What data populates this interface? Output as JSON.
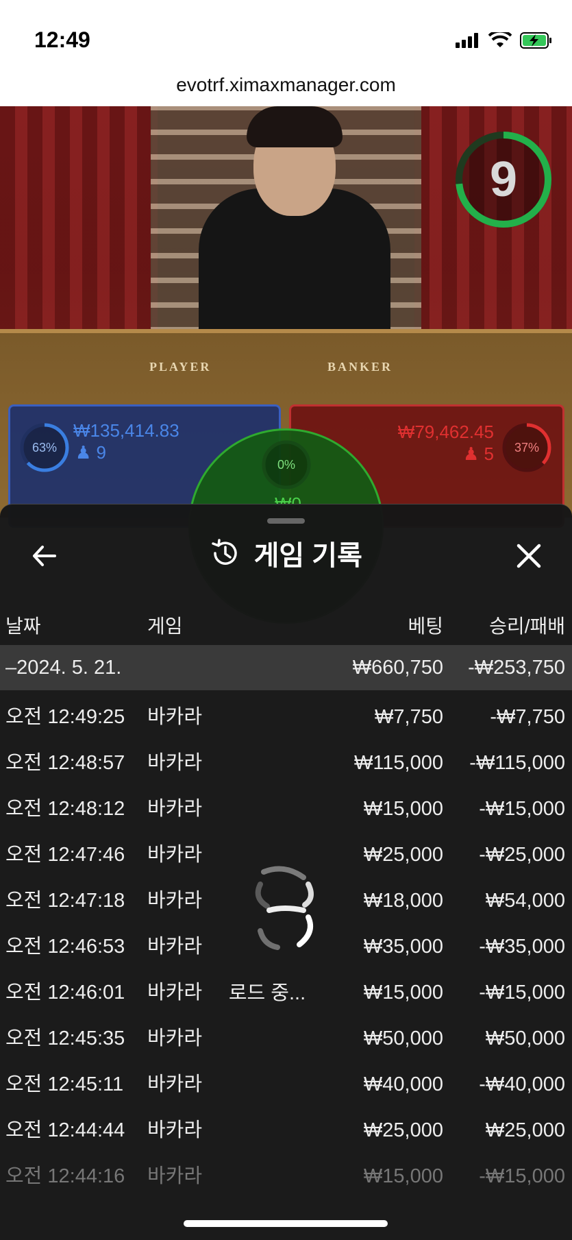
{
  "status_bar": {
    "time": "12:49"
  },
  "browser": {
    "url": "evotrf.ximaxmanager.com"
  },
  "game": {
    "timer": "9",
    "table_labels": {
      "player": "PLAYER",
      "banker": "BANKER"
    },
    "player": {
      "pct": "63%",
      "amount": "₩135,414.83",
      "count": "9"
    },
    "banker": {
      "pct": "37%",
      "amount": "₩79,462.45",
      "count": "5"
    },
    "tie": {
      "pct": "0%",
      "amount": "₩0"
    },
    "colors": {
      "player": "#3a5fc0",
      "banker": "#c03030",
      "tie": "#2faa2f"
    }
  },
  "sheet": {
    "title": "게임 기록",
    "columns": {
      "date": "날짜",
      "game": "게임",
      "bet": "베팅",
      "result": "승리/패배"
    },
    "summary": {
      "date": "–2024. 5. 21.",
      "bet": "₩660,750",
      "result": "-₩253,750"
    },
    "rows": [
      {
        "time": "오전 12:49:25",
        "game": "바카라",
        "bet": "₩7,750",
        "result": "-₩7,750"
      },
      {
        "time": "오전 12:48:57",
        "game": "바카라",
        "bet": "₩115,000",
        "result": "-₩115,000"
      },
      {
        "time": "오전 12:48:12",
        "game": "바카라",
        "bet": "₩15,000",
        "result": "-₩15,000"
      },
      {
        "time": "오전 12:47:46",
        "game": "바카라",
        "bet": "₩25,000",
        "result": "-₩25,000"
      },
      {
        "time": "오전 12:47:18",
        "game": "바카라",
        "bet": "₩18,000",
        "result": "₩54,000"
      },
      {
        "time": "오전 12:46:53",
        "game": "바카라",
        "bet": "₩35,000",
        "result": "-₩35,000"
      },
      {
        "time": "오전 12:46:01",
        "game": "바카라",
        "bet": "₩15,000",
        "result": "-₩15,000"
      },
      {
        "time": "오전 12:45:35",
        "game": "바카라",
        "bet": "₩50,000",
        "result": "₩50,000"
      },
      {
        "time": "오전 12:45:11",
        "game": "바카라",
        "bet": "₩40,000",
        "result": "-₩40,000"
      },
      {
        "time": "오전 12:44:44",
        "game": "바카라",
        "bet": "₩25,000",
        "result": "₩25,000"
      },
      {
        "time": "오전 12:44:16",
        "game": "바카라",
        "bet": "₩15,000",
        "result": "-₩15,000"
      }
    ],
    "loading_text": "로드 중..."
  }
}
